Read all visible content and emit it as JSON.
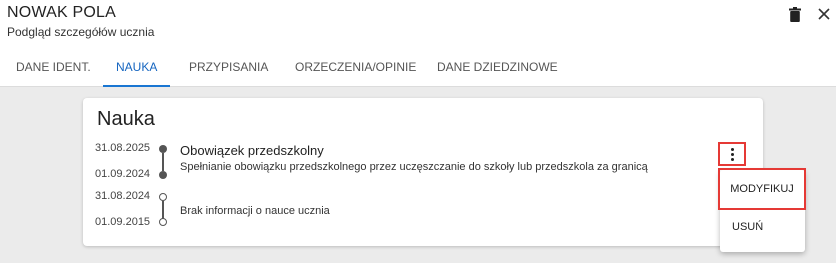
{
  "header": {
    "title": "NOWAK POLA",
    "subtitle": "Podgląd szczegółów ucznia"
  },
  "tabs": [
    {
      "label": "DANE IDENT."
    },
    {
      "label": "NAUKA"
    },
    {
      "label": "PRZYPISANIA"
    },
    {
      "label": "ORZECZENIA/OPINIE"
    },
    {
      "label": "DANE DZIEDZINOWE"
    }
  ],
  "active_tab": "NAUKA",
  "card": {
    "title": "Nauka",
    "entries": [
      {
        "date_to": "31.08.2025",
        "date_from": "01.09.2024",
        "title": "Obowiązek przedszkolny",
        "description": "Spełnianie obowiązku przedszkolnego przez uczęszczanie do szkoły lub przedszkola za granicą"
      },
      {
        "date_to": "31.08.2024",
        "date_from": "01.09.2015",
        "title": "",
        "description": "Brak informacji o nauce ucznia"
      }
    ]
  },
  "menu": {
    "items": [
      {
        "label": "MODYFIKUJ"
      },
      {
        "label": "USUŃ"
      }
    ]
  },
  "icons": {
    "delete": "trash-icon",
    "close": "close-icon",
    "more": "kebab-menu-icon"
  },
  "colors": {
    "accent": "#1976d2",
    "highlight_border": "#e53935"
  }
}
